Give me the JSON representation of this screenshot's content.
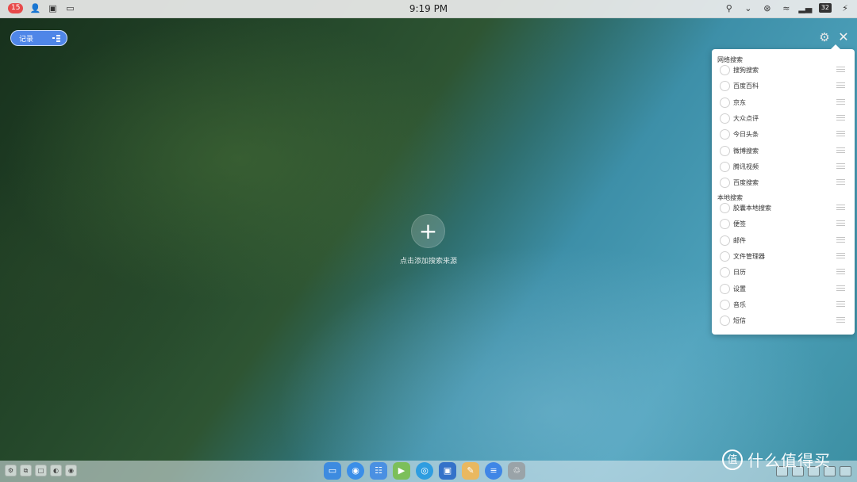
{
  "statusbar": {
    "badge": "15",
    "clock": "9:19 PM",
    "battery": "32"
  },
  "record_button": {
    "label": "记录"
  },
  "add_source": {
    "symbol": "+",
    "hint": "点击添加搜索来源"
  },
  "panel": {
    "web_section_title": "网络搜索",
    "web_items": [
      "搜狗搜索",
      "百度百科",
      "京东",
      "大众点评",
      "今日头条",
      "微博搜索",
      "腾讯视频",
      "百度搜索"
    ],
    "local_section_title": "本地搜索",
    "local_items": [
      "胶囊本地搜索",
      "便签",
      "邮件",
      "文件管理器",
      "日历",
      "设置",
      "音乐",
      "短信"
    ]
  },
  "dock": {
    "apps": [
      {
        "icon": "screen-app-icon",
        "color": "#3d8be0"
      },
      {
        "icon": "folder-app-icon",
        "color": "#3b8ee8"
      },
      {
        "icon": "grid-app-icon",
        "color": "#4a90e2"
      },
      {
        "icon": "video-app-icon",
        "color": "#7cbf5a"
      },
      {
        "icon": "browser-app-icon",
        "color": "#2f9de0"
      },
      {
        "icon": "image-app-icon",
        "color": "#3472c9"
      },
      {
        "icon": "notes-app-icon",
        "color": "#e9b860"
      },
      {
        "icon": "messages-app-icon",
        "color": "#3f86e6"
      },
      {
        "icon": "trash-icon",
        "color": "#9aa3a8"
      }
    ]
  },
  "watermark": {
    "logo": "值",
    "text": "什么值得买"
  }
}
